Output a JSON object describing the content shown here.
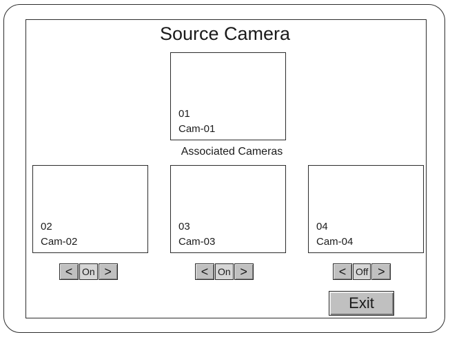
{
  "title": "Source Camera",
  "source_camera": {
    "number": "01",
    "name": "Cam-01"
  },
  "associated_label": "Associated Cameras",
  "associated_cameras": [
    {
      "number": "02",
      "name": "Cam-02",
      "state": "On"
    },
    {
      "number": "03",
      "name": "Cam-03",
      "state": "On"
    },
    {
      "number": "04",
      "name": "Cam-04",
      "state": "Off"
    }
  ],
  "controls": {
    "prev_label": "<",
    "next_label": ">"
  },
  "exit_label": "Exit"
}
